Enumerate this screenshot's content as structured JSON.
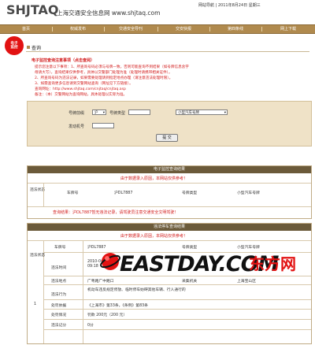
{
  "header": {
    "logo": "SHJTAQ",
    "site_name": "上海交通安全信息网",
    "site_url": "www.shjtaq.com",
    "utility": "网站导航 | 2011年8月24日 星期三"
  },
  "nav": {
    "items": [
      "首页",
      "权威发布",
      "交通安全导刊",
      "交安快报",
      "第四条线",
      "网上下载"
    ]
  },
  "badge": {
    "line1": "电子",
    "line2": "监控"
  },
  "section_title": "查询",
  "notice": {
    "heading": "电子监控查询注意事项（点击查阅）",
    "lines": [
      "提示您注意以下事项：1、所查询号码必须与号牌一致，否则可能查询不到结果（如号牌信息含字",
      "母请大写），查询结果仅供参考，具体以交警部门处理为准（处理时请携带相关证件）。",
      "2、所查询号码为违法记录，如果需要处理请到指定地点办理（请注意违法处理时限）。",
      "3、如需查询更多信息请到交警网站查询（网址见下方链接）。",
      "查询网址：http://www.shjtaq.com/cnjtaq/cnjtaq.asp",
      "备注：（本）交警网站为查询网站，具体处理以实际为准。"
    ]
  },
  "form": {
    "plate_label": "号牌前缀",
    "plate_prefix": "沪",
    "plate_type_label": "号牌类型",
    "plate_type_value": "小型汽车号牌",
    "engine_label": "发动机号",
    "submit_label": "提 交"
  },
  "panel1": {
    "title": "电子监控查询结果",
    "notice": "由于数据录入原因，本网站仅供参考！",
    "cols": [
      "违法状态",
      "车牌号",
      "沪DL7887",
      "号牌类型",
      "小型汽车号牌"
    ],
    "footer": "查询结果：沪DL7887暂无违法记录，请驾驶员注意交通安全文明驾驶！"
  },
  "panel2": {
    "title": "违法停车查询结果",
    "notice": "由于数据录入原因，本网站仅供参考！",
    "row_index": "1",
    "row_labels": [
      "违法状态",
      "违法时间",
      "违法地点",
      "违法行为",
      "处罚依据",
      "处罚情况",
      "违法记分"
    ],
    "plate_label": "车牌号",
    "plate_value": "沪DL7887",
    "type_label": "号牌类型",
    "type_value": "小型汽车号牌",
    "time_value": "2010-04-28 09:18",
    "place_value": "广粤路广中路口",
    "police_label": "采集机关",
    "police_value": "上海宝山区",
    "behavior_value": "机动车违反规定停放、临时停车妨碍其他车辆、行人通行的",
    "basis_value": "《上海市》第33条，《条例》第83条",
    "penalty_value": "罚款 200元（200 元）",
    "score_value": "0分"
  },
  "watermark": {
    "text": "EASTDAY.COM",
    "cn": "东方网"
  },
  "colors": {
    "accent": "#b08a4e",
    "alert": "#d21b1b",
    "panel_head": "#6b5a3a"
  }
}
